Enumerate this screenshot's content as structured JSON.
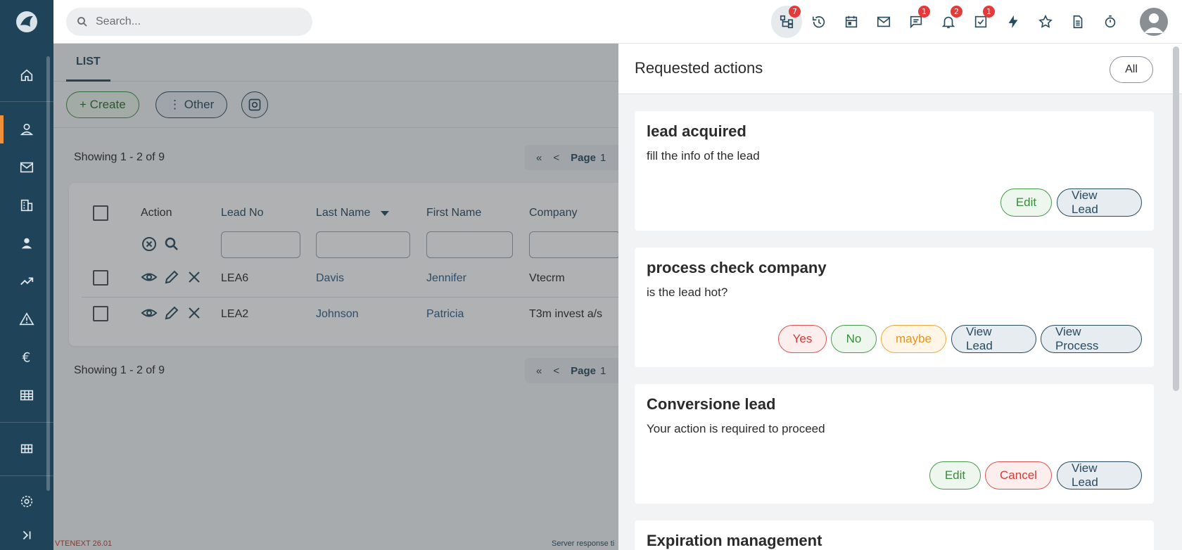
{
  "search": {
    "placeholder": "Search..."
  },
  "topbar": {
    "badges": {
      "processes": "7",
      "talks": "1",
      "notifications": "2",
      "todos": "1"
    }
  },
  "tabs": [
    {
      "label": "LIST"
    }
  ],
  "toolbar": {
    "create_label": "+ Create",
    "other_label": "⋮ Other"
  },
  "list": {
    "showing_text": "Showing 1 - 2 of 9",
    "pager": {
      "first": "«",
      "prev": "<",
      "page_label": "Page",
      "page_number": "1"
    },
    "columns": [
      "Action",
      "Lead No",
      "Last Name",
      "First Name",
      "Company"
    ],
    "rows": [
      {
        "lead_no": "LEA6",
        "last_name": "Davis",
        "first_name": "Jennifer",
        "company": "Vtecrm"
      },
      {
        "lead_no": "LEA2",
        "last_name": "Johnson",
        "first_name": "Patricia",
        "company": "T3m invest a/s"
      }
    ]
  },
  "footer": {
    "version": "VTENEXT 26.01",
    "server": "Server response ti"
  },
  "panel": {
    "title": "Requested actions",
    "all_label": "All",
    "cards": [
      {
        "title": "lead acquired",
        "desc": "fill the info of the lead",
        "buttons": [
          "Edit",
          "View Lead"
        ]
      },
      {
        "title": "process check company",
        "desc": "is the lead hot?",
        "buttons": [
          "Yes",
          "No",
          "maybe",
          "View Lead",
          "View Process"
        ]
      },
      {
        "title": "Conversione lead",
        "desc": "Your action is required to proceed",
        "buttons": [
          "Edit",
          "Cancel",
          "View Lead"
        ]
      },
      {
        "title": "Expiration management",
        "desc": "",
        "buttons": []
      }
    ]
  },
  "colors": {
    "sidebar": "#1f4358",
    "accent": "#f0913a",
    "badge": "#e23b3b"
  }
}
